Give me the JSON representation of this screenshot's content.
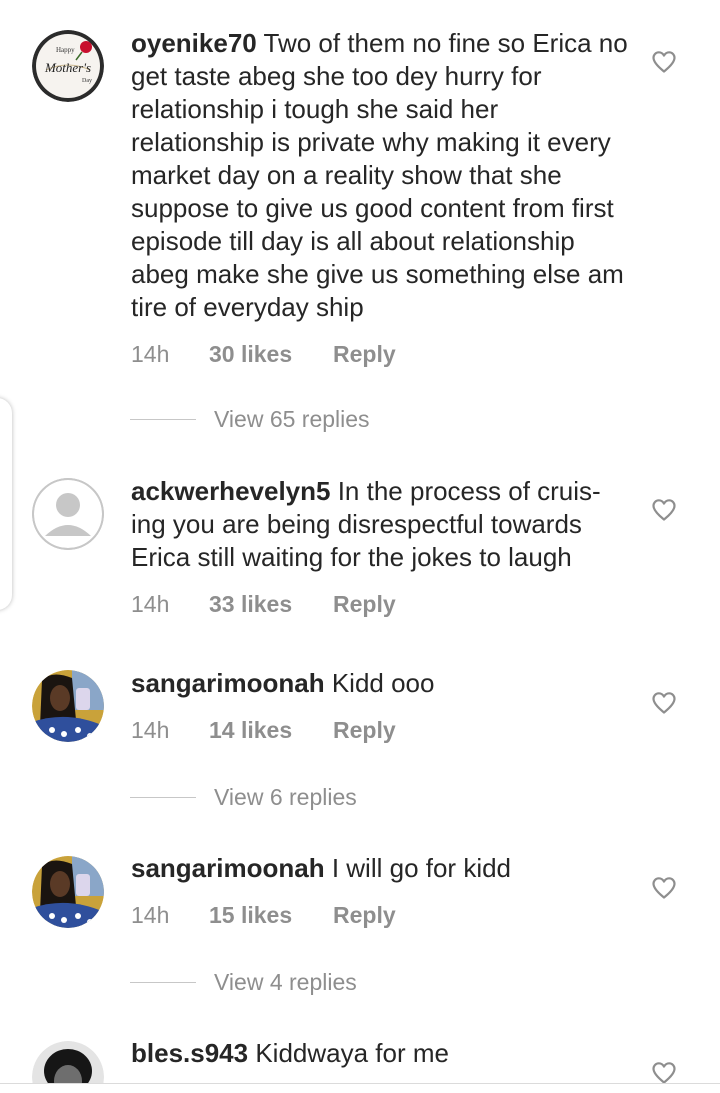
{
  "comments": [
    {
      "username": "oyenike70",
      "text": "Two of them no fine so Erica no get taste abeg she too dey hurry for relationship i tough she said her relationship is private why making it every market day on a reality show that she suppose to give us good content from first episode till day is all about relationship abeg make she give us something else am tire of everyday ship",
      "time": "14h",
      "likes": "30 likes",
      "reply": "Reply",
      "avatar_text": [
        "Happy",
        "Mother's",
        "Day"
      ]
    },
    {
      "username": "ackwerhevelyn5",
      "text": "In the process of cruis-ing you are being disrespectful towards Erica still waiting for the jokes to laugh",
      "time": "14h",
      "likes": "33 likes",
      "reply": "Reply"
    },
    {
      "username": "sangarimoonah",
      "text": "Kidd ooo",
      "time": "14h",
      "likes": "14 likes",
      "reply": "Reply"
    },
    {
      "username": "sangarimoonah",
      "text": "I will go for kidd",
      "time": "14h",
      "likes": "15 likes",
      "reply": "Reply"
    },
    {
      "username": "bles.s943",
      "text": "Kiddwaya for me"
    }
  ],
  "view_replies": [
    "View 65 replies",
    "View 6 replies",
    "View 4 replies"
  ],
  "icons": {
    "like": "heart-outline-icon",
    "default_avatar": "default-user-icon"
  },
  "colors": {
    "text": "#262626",
    "secondary": "#8e8e8e",
    "divider": "#c7c7c7"
  }
}
